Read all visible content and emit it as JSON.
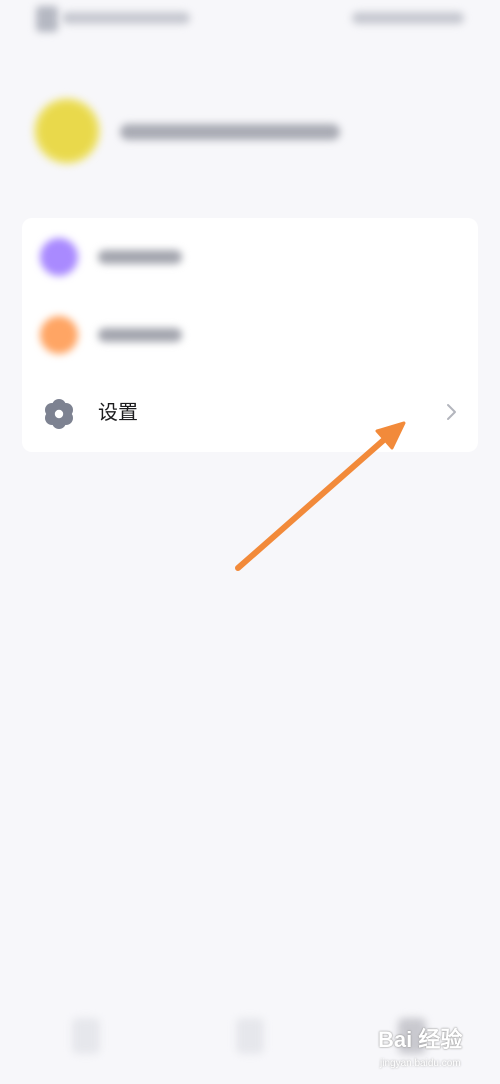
{
  "settings_menu": {
    "settings_label": "设置",
    "settings_icon": "gear-icon",
    "chevron_icon": "chevron-right-icon"
  },
  "annotation": {
    "arrow_color": "#f28a3a"
  },
  "watermark": {
    "logo_text": "Bai 经验",
    "sub_text": "jingyan.baidu.com"
  },
  "colors": {
    "background": "#f7f7fa",
    "card": "#ffffff",
    "purple_icon": "#a98aff",
    "orange_icon": "#ffa564",
    "avatar": "#e9d94b",
    "gear": "#7d8291"
  }
}
